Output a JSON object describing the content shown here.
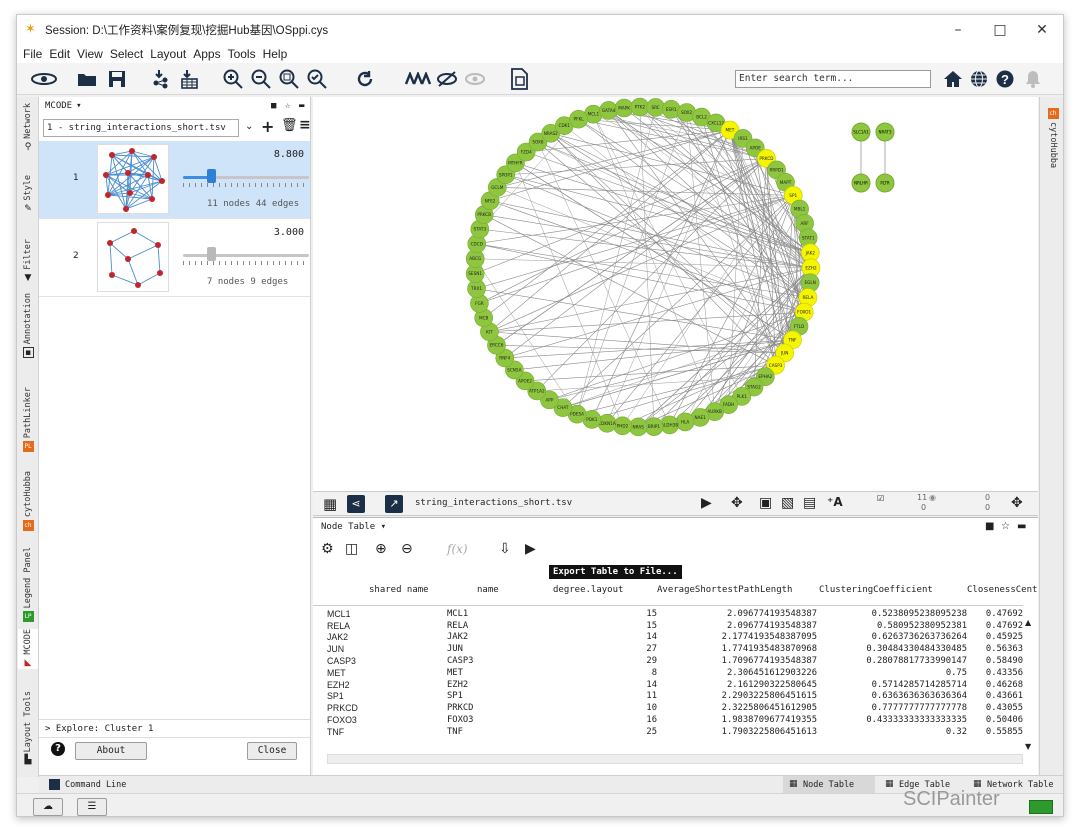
{
  "window": {
    "title": "Session: D:\\工作资料\\案例复现\\挖掘Hub基因\\OSppi.cys"
  },
  "menu": [
    "File",
    "Edit",
    "View",
    "Select",
    "Layout",
    "Apps",
    "Tools",
    "Help"
  ],
  "search": {
    "placeholder": "Enter search term..."
  },
  "left_tabs": [
    "Network",
    "Style",
    "Filter",
    "Annotation",
    "PathLinker",
    "cytoHubba",
    "Legend Panel",
    "MCODE",
    "Layout Tools"
  ],
  "left_tab_badges": {
    "pathlinker": "PL",
    "cytohubba": "ch",
    "legend": "LP"
  },
  "mcode": {
    "panel_title": "MCODE",
    "network_select": "1 - string_interactions_short.tsv",
    "clusters": [
      {
        "rank": "1",
        "score": "8.800",
        "info": "11 nodes  44 edges",
        "slider": 0.22
      },
      {
        "rank": "2",
        "score": "3.000",
        "info": "7 nodes  9 edges",
        "slider": 0.22
      }
    ],
    "explore": "> Explore: Cluster 1",
    "about": "About",
    "close": "Close"
  },
  "right_tab": "cytoHubba",
  "right_tab_badge": "ch",
  "network": {
    "circle_nodes": [
      "MCL1",
      "GATA4",
      "MAPK",
      "PTK2",
      "SRC",
      "ESR1",
      "SOX2",
      "BCL2",
      "CXCL12",
      "MET",
      "IRS1",
      "APOE",
      "PRKCD",
      "RRPD1",
      "MAPT",
      "SP1",
      "MBL1",
      "ARF",
      "STAT1",
      "JAK2",
      "EZH2",
      "EGLN",
      "RELA",
      "FOXO1",
      "FTLD",
      "TNF",
      "JUN",
      "CASP3",
      "EPHA2",
      "STAG2",
      "PLK1",
      "FADH",
      "AURKB",
      "NAE1",
      "HLA",
      "ALDH3B",
      "BRIP1",
      "NRAS",
      "PHD2",
      "CDKN1A",
      "PDK1",
      "PDE5A",
      "CHAT",
      "APP",
      "ATP1A2",
      "APOE2",
      "SCN5A",
      "RNF4",
      "ERCC6",
      "KIT",
      "MCB",
      "FGR",
      "TRX1",
      "SESN1",
      "ABCG",
      "CDCD",
      "STAT3",
      "PRKCB",
      "NFE2",
      "GCLM",
      "SPOP1",
      "MTHFR",
      "FZD4",
      "SOX8",
      "NRAS2",
      "CDK1",
      "PFKL"
    ],
    "highlight_nodes": [
      "MET",
      "PRKCD",
      "SP1",
      "JAK2",
      "EZH2",
      "RELA",
      "FOXO1",
      "TNF",
      "JUN",
      "CASP3"
    ],
    "side_nodes": [
      "SLC1A1",
      "NRAT3",
      "NRLHR",
      "PLTR"
    ],
    "tab_label": "string_interactions_short.tsv",
    "counts": {
      "nodes_sel": "11",
      "nodes_total": "0",
      "edges_sel": "0",
      "edges_total": "0"
    }
  },
  "node_table": {
    "title": "Node Table",
    "tooltip": "Export Table to File...",
    "fx": "f(x)",
    "columns": [
      "shared name",
      "name",
      "degree.layout",
      "AverageShortestPathLength",
      "ClusteringCoefficient",
      "ClosenessCent"
    ],
    "rows": [
      [
        "MCL1",
        "MCL1",
        "15",
        "2.096774193548387",
        "0.5238095238095238",
        "0.47692"
      ],
      [
        "RELA",
        "RELA",
        "15",
        "2.096774193548387",
        "0.580952380952381",
        "0.47692"
      ],
      [
        "JAK2",
        "JAK2",
        "14",
        "2.1774193548387095",
        "0.6263736263736264",
        "0.45925"
      ],
      [
        "JUN",
        "JUN",
        "27",
        "1.7741935483870968",
        "0.30484330484330485",
        "0.56363"
      ],
      [
        "CASP3",
        "CASP3",
        "29",
        "1.7096774193548387",
        "0.28078817733990147",
        "0.58490"
      ],
      [
        "MET",
        "MET",
        "8",
        "2.306451612903226",
        "0.75",
        "0.43356"
      ],
      [
        "EZH2",
        "EZH2",
        "14",
        "2.161290322580645",
        "0.5714285714285714",
        "0.46268"
      ],
      [
        "SP1",
        "SP1",
        "11",
        "2.2903225806451615",
        "0.6363636363636364",
        "0.43661"
      ],
      [
        "PRKCD",
        "PRKCD",
        "10",
        "2.3225806451612905",
        "0.7777777777777778",
        "0.43055"
      ],
      [
        "FOXO3",
        "FOXO3",
        "16",
        "1.9838709677419355",
        "0.43333333333333335",
        "0.50406"
      ],
      [
        "TNF",
        "TNF",
        "25",
        "1.7903225806451613",
        "0.32",
        "0.55855"
      ]
    ]
  },
  "bottom_tabs": [
    "Node Table",
    "Edge Table",
    "Network Table"
  ],
  "command_line": "Command Line",
  "watermark": "SCIPainter"
}
